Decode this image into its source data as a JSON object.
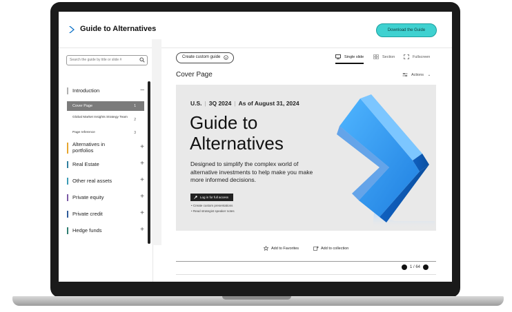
{
  "app": {
    "title": "Guide to Alternatives",
    "download_label": "Download the Guide"
  },
  "search": {
    "placeholder": "Search the guide by title or slide #"
  },
  "nav": {
    "sections": [
      {
        "label": "Introduction",
        "color": "#b0b0b0",
        "toggle": "–"
      },
      {
        "label": "Alternatives in portfolios",
        "color": "#e6a52e",
        "toggle": "+"
      },
      {
        "label": "Real Estate",
        "color": "#2f7f9f",
        "toggle": "+"
      },
      {
        "label": "Other real assets",
        "color": "#3b9bb5",
        "toggle": "+"
      },
      {
        "label": "Private equity",
        "color": "#7c5aa6",
        "toggle": "+"
      },
      {
        "label": "Private credit",
        "color": "#2e5b9a",
        "toggle": "+"
      },
      {
        "label": "Hedge funds",
        "color": "#2f7d70",
        "toggle": "+"
      }
    ],
    "subitems": [
      {
        "label": "Cover Page",
        "num": "1"
      },
      {
        "label": "Global Market Insights Strategy Team",
        "num": "2"
      },
      {
        "label": "Page reference",
        "num": "3"
      }
    ]
  },
  "toolbar": {
    "create_label": "Create custom guide",
    "views": [
      {
        "label": "Single slide",
        "icon": "monitor-icon"
      },
      {
        "label": "Section",
        "icon": "grid-icon"
      },
      {
        "label": "Fullscreen",
        "icon": "expand-icon"
      }
    ],
    "actions_label": "Actions"
  },
  "page": {
    "title": "Cover Page"
  },
  "slide": {
    "meta": [
      "U.S.",
      "3Q 2024",
      "As of August 31, 2024"
    ],
    "title_line1": "Guide to",
    "title_line2": "Alternatives",
    "description": "Designed to simplify the complex world of alternative investments to help make you make more informed decisions.",
    "login_label": "Log in for full access",
    "bullets": [
      "Create custom presentations",
      "Read strategist speaker notes"
    ]
  },
  "footer": {
    "favorites_label": "Add to Favorites",
    "collection_label": "Add to collection",
    "pager": "1 / 64"
  },
  "colors": {
    "accent": "#3fd1d0",
    "chevron": "#1e90ff"
  }
}
